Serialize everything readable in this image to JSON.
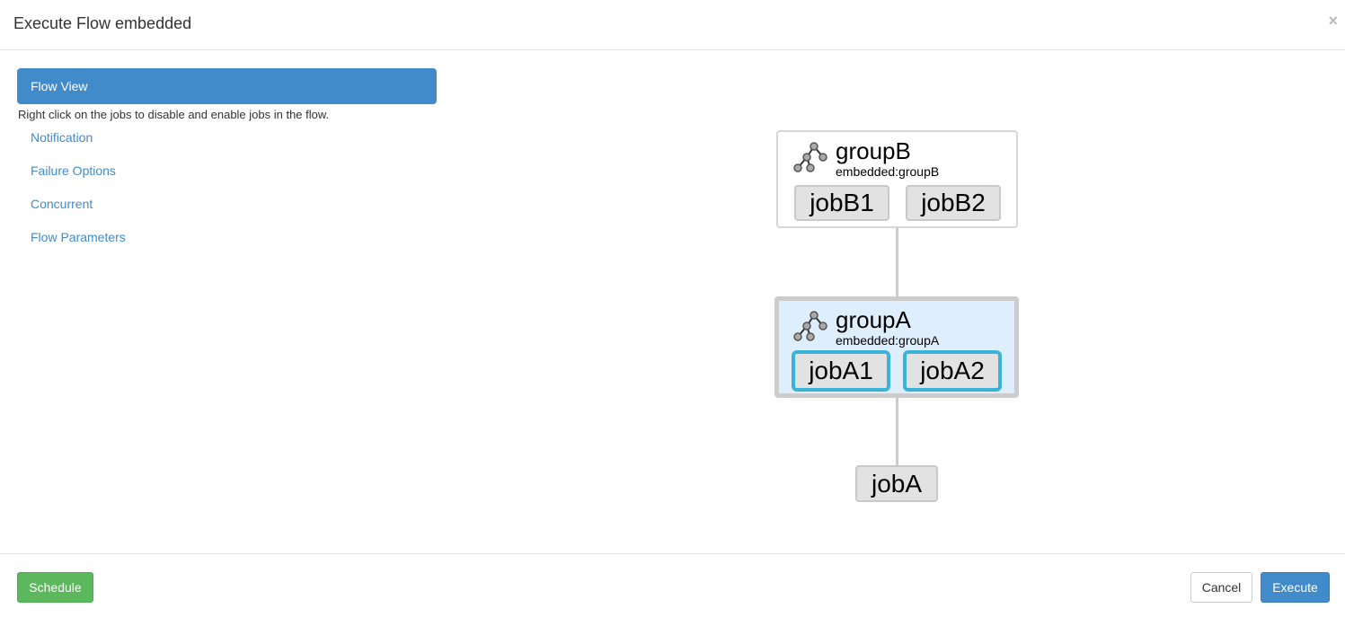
{
  "modal": {
    "title": "Execute Flow embedded",
    "close_glyph": "×"
  },
  "nav": {
    "active_label": "Flow View",
    "help_text": "Right click on the jobs to disable and enable jobs in the flow.",
    "items": [
      {
        "label": "Notification"
      },
      {
        "label": "Failure Options"
      },
      {
        "label": "Concurrent"
      },
      {
        "label": "Flow Parameters"
      }
    ]
  },
  "graph": {
    "groupB": {
      "name": "groupB",
      "subtitle": "embedded:groupB",
      "icon": "tree-icon",
      "jobs": [
        {
          "name": "jobB1"
        },
        {
          "name": "jobB2"
        }
      ]
    },
    "groupA": {
      "name": "groupA",
      "subtitle": "embedded:groupA",
      "icon": "tree-icon",
      "selected": true,
      "jobs": [
        {
          "name": "jobA1"
        },
        {
          "name": "jobA2"
        }
      ]
    },
    "jobA": {
      "name": "jobA"
    }
  },
  "footer": {
    "schedule_label": "Schedule",
    "cancel_label": "Cancel",
    "execute_label": "Execute"
  },
  "colors": {
    "primary": "#428bca",
    "success": "#5cb85c",
    "selected_group_bg": "#dfeefd",
    "focused_job_border": "#3bb3d8"
  }
}
